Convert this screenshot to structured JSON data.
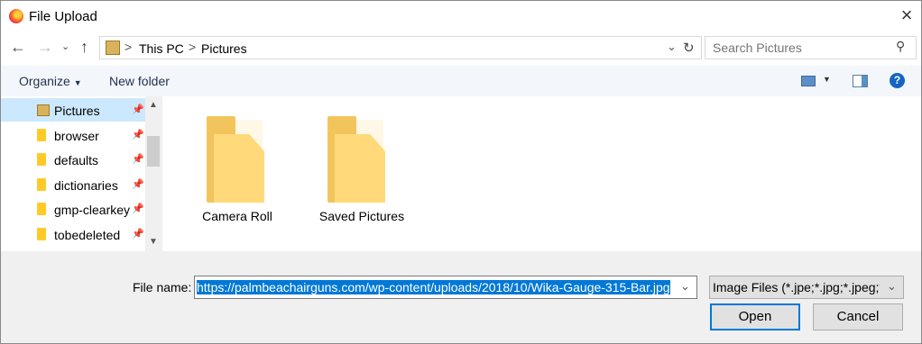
{
  "window": {
    "title": "File Upload"
  },
  "address": {
    "crumbs": [
      "This PC",
      "Pictures"
    ],
    "separator": ">"
  },
  "search": {
    "placeholder": "Search Pictures"
  },
  "toolbar": {
    "organize": "Organize",
    "new_folder": "New folder"
  },
  "sidebar": {
    "items": [
      {
        "label": "Pictures",
        "selected": true
      },
      {
        "label": "browser"
      },
      {
        "label": "defaults"
      },
      {
        "label": "dictionaries"
      },
      {
        "label": "gmp-clearkey"
      },
      {
        "label": "tobedeleted"
      }
    ]
  },
  "files": [
    {
      "name": "Camera Roll"
    },
    {
      "name": "Saved Pictures"
    }
  ],
  "footer": {
    "file_name_label": "File name:",
    "file_name_value": "https://palmbeachairguns.com/wp-content/uploads/2018/10/Wika-Gauge-315-Bar.jpg",
    "file_type": "Image Files (*.jpe;*.jpg;*.jpeg;*.g",
    "open_label": "Open",
    "cancel_label": "Cancel"
  },
  "colors": {
    "accent": "#0078d7",
    "selection": "#cce8ff",
    "toolbar_bg": "#f3f6fb",
    "folder": "#ffd97a"
  }
}
